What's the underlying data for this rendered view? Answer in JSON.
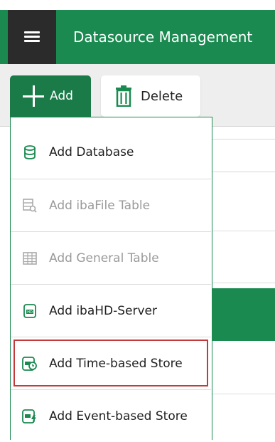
{
  "header": {
    "title": "Datasource Management"
  },
  "toolbar": {
    "add_label": "Add",
    "delete_label": "Delete"
  },
  "add_menu": {
    "items": [
      {
        "label": "Add Database",
        "icon": "database-icon",
        "enabled": true
      },
      {
        "label": "Add ibaFile Table",
        "icon": "file-table-search-icon",
        "enabled": false
      },
      {
        "label": "Add General Table",
        "icon": "table-grid-icon",
        "enabled": false
      },
      {
        "label": "Add ibaHD-Server",
        "icon": "hd-server-icon",
        "enabled": true
      },
      {
        "label": "Add Time-based Store",
        "icon": "time-store-icon",
        "enabled": true,
        "highlighted": true
      },
      {
        "label": "Add Event-based Store",
        "icon": "event-store-icon",
        "enabled": true
      }
    ]
  },
  "colors": {
    "brand_green": "#1a8a50",
    "highlight_border": "#c23a3a",
    "menu_dark": "#2b2b2b"
  }
}
